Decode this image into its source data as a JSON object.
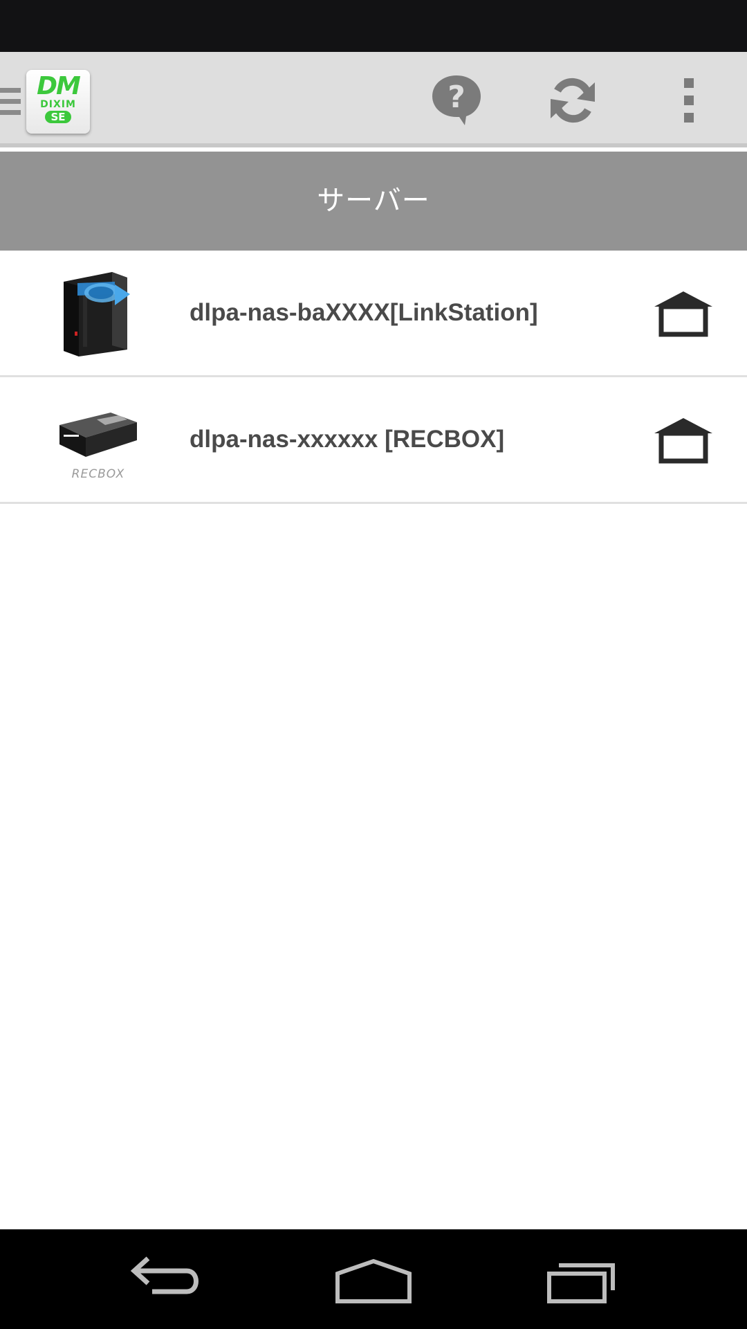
{
  "app": {
    "logo_text_top": "DM",
    "logo_text_mid": "DIXIM",
    "logo_text_badge": "SE"
  },
  "toolbar": {
    "actions": [
      "help-icon",
      "refresh-icon",
      "overflow-menu-icon"
    ]
  },
  "section": {
    "title": "サーバー"
  },
  "servers": [
    {
      "name": "dlpa-nas-baXXXX[LinkStation]",
      "thumbnail": "linkstation-nas-icon",
      "action_icon": "home-icon"
    },
    {
      "name": "dlpa-nas-xxxxxx [RECBOX]",
      "thumbnail": "recbox-nas-icon",
      "thumbnail_caption": "RECBOX",
      "action_icon": "home-icon"
    }
  ],
  "colors": {
    "status_bar": "#121214",
    "action_bar": "#dedede",
    "section_header": "#939393",
    "logo_green": "#3cc83c",
    "nav_bar": "#000000"
  },
  "nav": {
    "buttons": [
      "back-icon",
      "home-nav-icon",
      "recent-apps-icon"
    ]
  }
}
